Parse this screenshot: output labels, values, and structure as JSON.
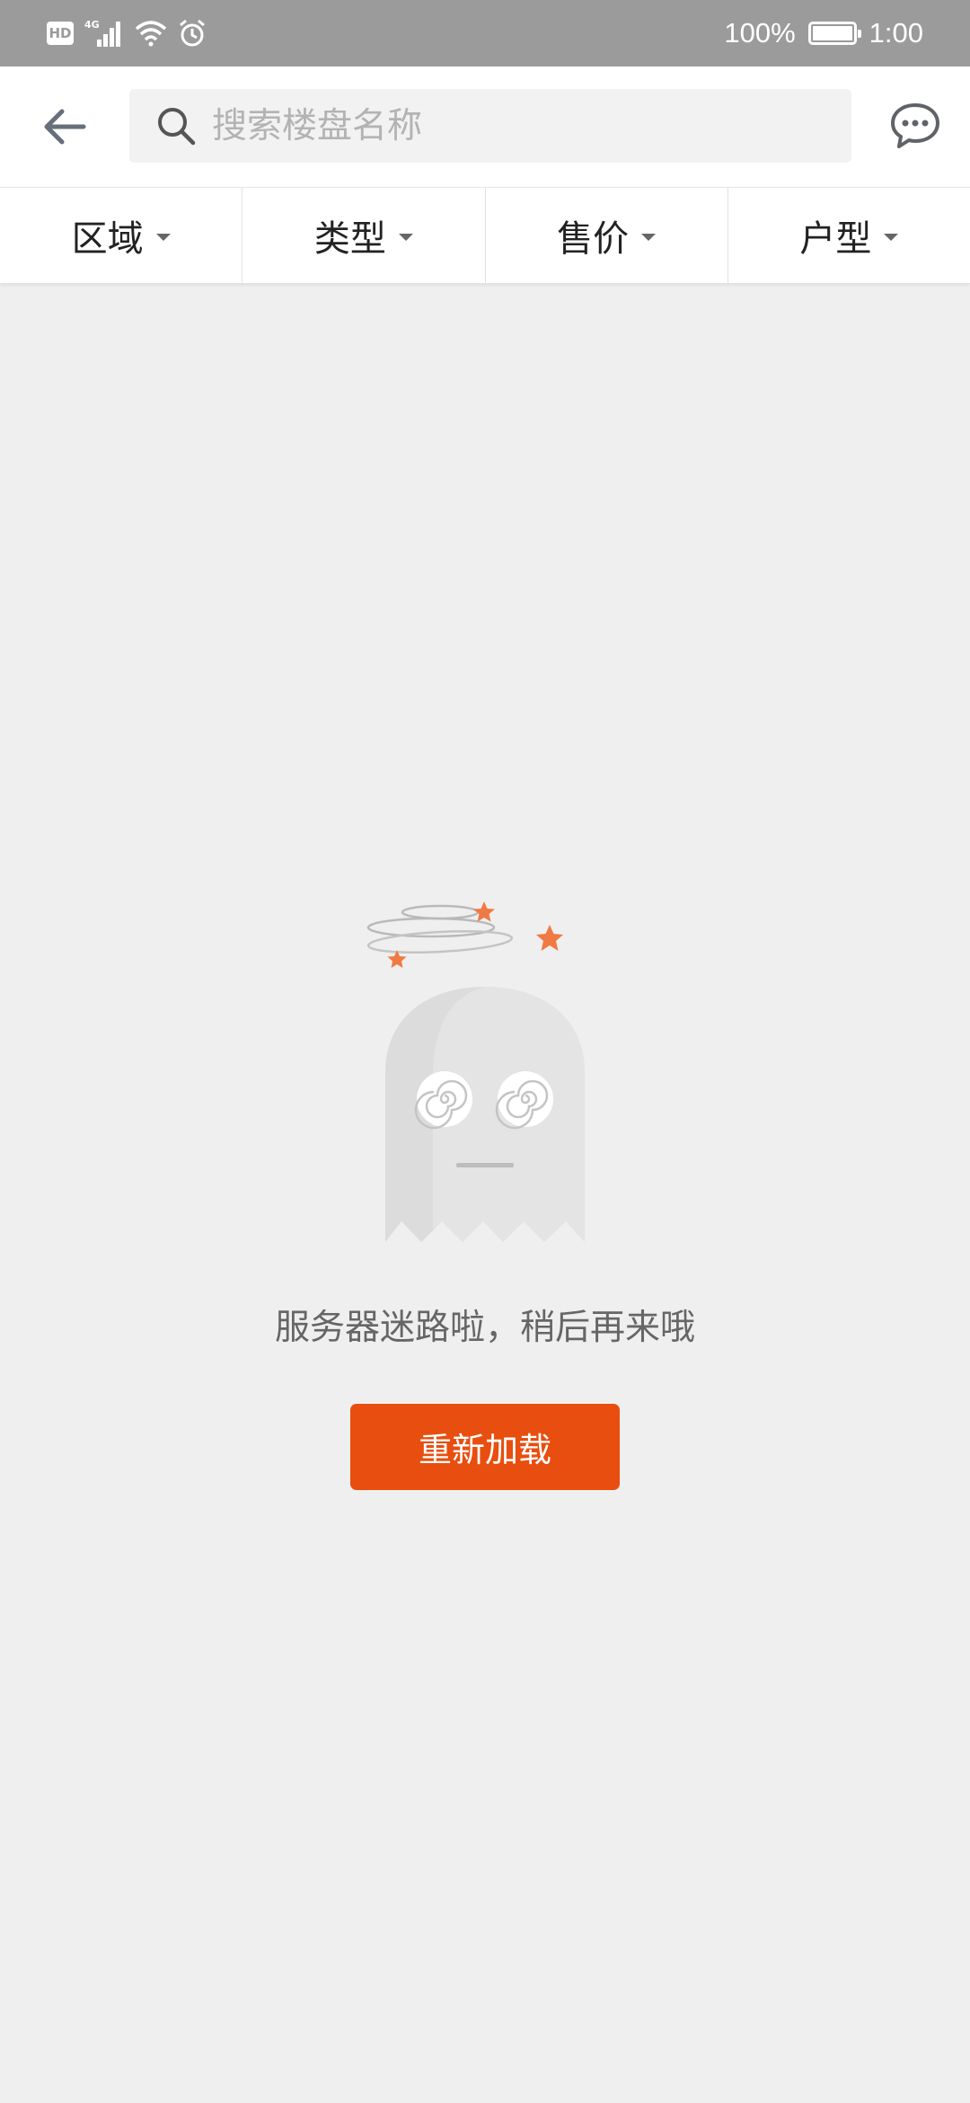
{
  "status_bar": {
    "hd_badge": "HD",
    "network": "4G",
    "battery": "100%",
    "battery_level": 1.0,
    "time": "1:00"
  },
  "header": {
    "back_icon": "arrow-left-icon",
    "search_placeholder": "搜索楼盘名称",
    "search_value": "",
    "search_icon": "search-icon",
    "message_icon": "chat-bubble-icon"
  },
  "filters": [
    {
      "label": "区域"
    },
    {
      "label": "类型"
    },
    {
      "label": "售价"
    },
    {
      "label": "户型"
    }
  ],
  "empty_state": {
    "illustration": "dizzy-ghost-illustration",
    "message": "服务器迷路啦，稍后再来哦",
    "reload_label": "重新加载"
  },
  "colors": {
    "status_bar": "#9b9b9b",
    "background": "#efefef",
    "accent": "#e84e0f",
    "star": "#f07a43"
  }
}
